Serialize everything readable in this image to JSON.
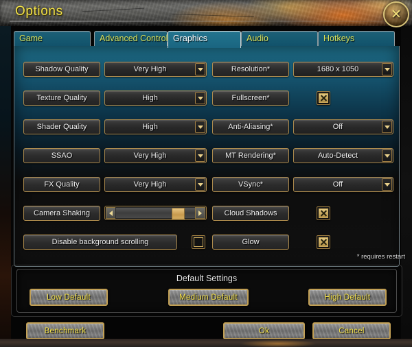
{
  "window": {
    "title": "Options",
    "close_icon": "close-x-icon"
  },
  "tabs": [
    {
      "label": "Game",
      "active": false
    },
    {
      "label": "Advanced Controls",
      "active": false
    },
    {
      "label": "Graphics",
      "active": true
    },
    {
      "label": "Audio",
      "active": false
    },
    {
      "label": "Hotkeys",
      "active": false
    }
  ],
  "graphics": {
    "left_column": [
      {
        "label": "Shadow Quality",
        "control": "dropdown",
        "value": "Very High"
      },
      {
        "label": "Texture Quality",
        "control": "dropdown",
        "value": "High"
      },
      {
        "label": "Shader Quality",
        "control": "dropdown",
        "value": "High"
      },
      {
        "label": "SSAO",
        "control": "dropdown",
        "value": "Very High"
      },
      {
        "label": "FX Quality",
        "control": "dropdown",
        "value": "Very High"
      },
      {
        "label": "Camera Shaking",
        "control": "slider",
        "value": 85
      },
      {
        "label": "Disable background scrolling",
        "control": "checkbox",
        "checked": false
      }
    ],
    "right_column": [
      {
        "label": "Resolution*",
        "control": "dropdown",
        "value": "1680 x 1050"
      },
      {
        "label": "Fullscreen*",
        "control": "checkbox",
        "checked": true
      },
      {
        "label": "Anti-Aliasing*",
        "control": "dropdown",
        "value": "Off"
      },
      {
        "label": "MT Rendering*",
        "control": "dropdown",
        "value": "Auto-Detect"
      },
      {
        "label": "VSync*",
        "control": "dropdown",
        "value": "Off"
      },
      {
        "label": "Cloud Shadows",
        "control": "checkbox",
        "checked": true
      },
      {
        "label": "Glow",
        "control": "checkbox",
        "checked": true
      }
    ],
    "restart_note": "* requires restart"
  },
  "defaults": {
    "title": "Default Settings",
    "buttons": [
      "Low Default",
      "Medium Default",
      "High Default"
    ]
  },
  "actions": {
    "benchmark": "Benchmark",
    "ok": "Ok",
    "cancel": "Cancel"
  },
  "colors": {
    "accent_gold": "#c2a055",
    "title_yellow": "#f2e14a",
    "tab_text": "#d8e25c",
    "panel_teal": "#1d6b85"
  }
}
